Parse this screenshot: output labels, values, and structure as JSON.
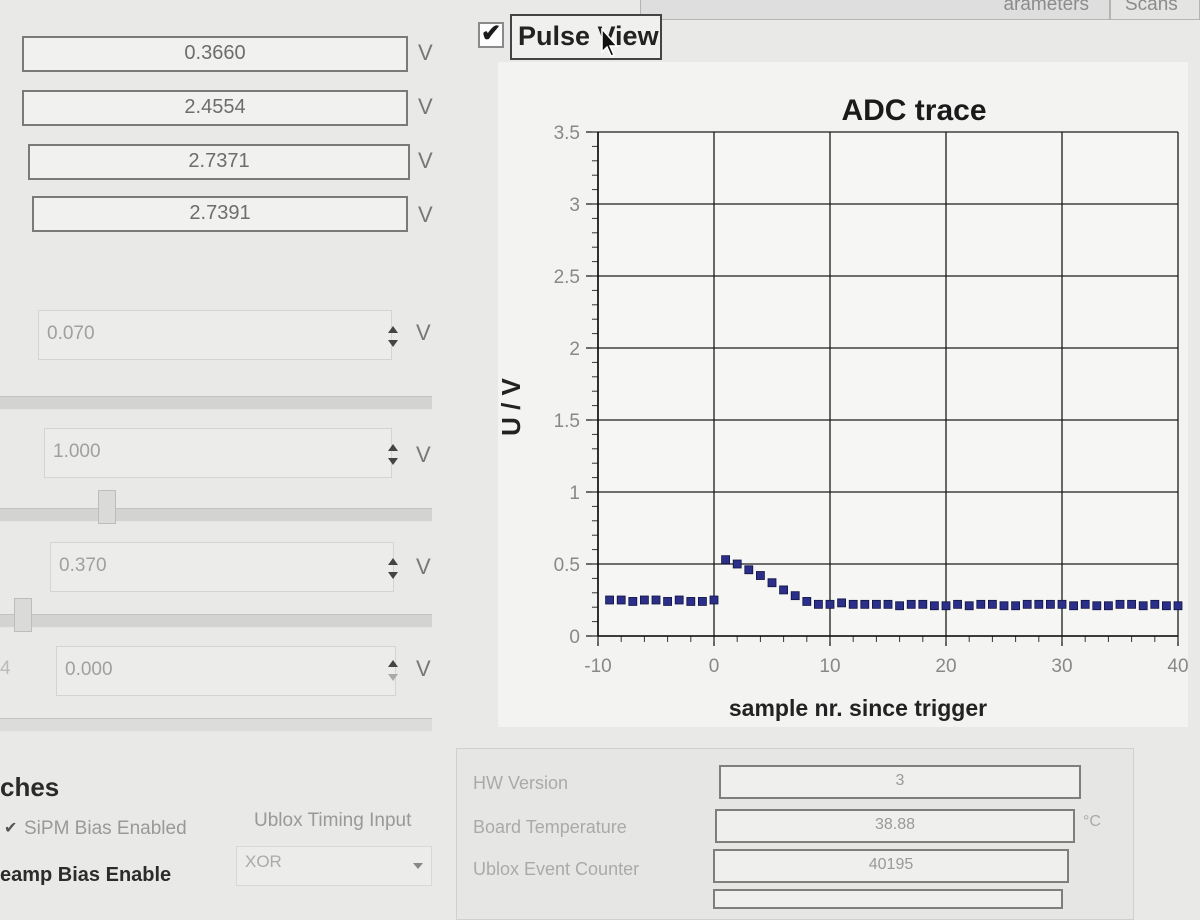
{
  "tabs": {
    "parameters": "arameters",
    "scans": "Scans"
  },
  "readouts": [
    {
      "value": "0.3660",
      "unit": "V"
    },
    {
      "value": "2.4554",
      "unit": "V"
    },
    {
      "value": "2.7371",
      "unit": "V"
    },
    {
      "value": "2.7391",
      "unit": "V"
    }
  ],
  "spinboxes": [
    {
      "value": "0.070",
      "unit": "V",
      "slider_level": 0.0
    },
    {
      "value": "1.000",
      "unit": "V",
      "slider_level": 0.25
    },
    {
      "value": "0.370",
      "unit": "V",
      "slider_level": 0.03
    },
    {
      "value": "0.000",
      "unit": "V",
      "row_label": "4"
    }
  ],
  "pulse_view": {
    "label": "Pulse View",
    "checked": true,
    "check_glyph": "✔"
  },
  "chart_data": {
    "type": "scatter",
    "title": "ADC trace",
    "xlabel": "sample nr. since trigger",
    "ylabel": "U / V",
    "xlim": [
      -10,
      40
    ],
    "ylim": [
      0,
      3.5
    ],
    "xticks": [
      "-10",
      "0",
      "10",
      "20",
      "30",
      "40"
    ],
    "yticks": [
      "0",
      "0.5",
      "1",
      "1.5",
      "2",
      "2.5",
      "3",
      "3.5"
    ],
    "grid": true,
    "marker_color": "#2b2f8a",
    "series": [
      {
        "x": [
          -9,
          -8,
          -7,
          -6,
          -5,
          -4,
          -3,
          -2,
          -1,
          0,
          1,
          2,
          3,
          4,
          5,
          6,
          7,
          8,
          9,
          10,
          11,
          12,
          13,
          14,
          15,
          16,
          17,
          18,
          19,
          20,
          21,
          22,
          23,
          24,
          25,
          26,
          27,
          28,
          29,
          30,
          31,
          32,
          33,
          34,
          35,
          36,
          37,
          38,
          39,
          40
        ],
        "values": [
          0.25,
          0.25,
          0.24,
          0.25,
          0.25,
          0.24,
          0.25,
          0.24,
          0.24,
          0.25,
          0.53,
          0.5,
          0.46,
          0.42,
          0.37,
          0.32,
          0.28,
          0.24,
          0.22,
          0.22,
          0.23,
          0.22,
          0.22,
          0.22,
          0.22,
          0.21,
          0.22,
          0.22,
          0.21,
          0.21,
          0.22,
          0.21,
          0.22,
          0.22,
          0.21,
          0.21,
          0.22,
          0.22,
          0.22,
          0.22,
          0.21,
          0.22,
          0.21,
          0.21,
          0.22,
          0.22,
          0.21,
          0.22,
          0.21,
          0.21
        ]
      }
    ]
  },
  "switches": {
    "title": "ches",
    "sipm_bias_label": "SiPM Bias Enabled",
    "preamp_bias_label": "eamp Bias Enable",
    "ublox_timing_label": "Ublox Timing Input",
    "ublox_timing_value": "XOR"
  },
  "info": {
    "hw_version_label": "HW Version",
    "hw_version_value": "3",
    "board_temp_label": "Board Temperature",
    "board_temp_value": "38.88",
    "board_temp_unit": "°C",
    "event_counter_label": "Ublox Event Counter",
    "event_counter_value": "40195"
  }
}
